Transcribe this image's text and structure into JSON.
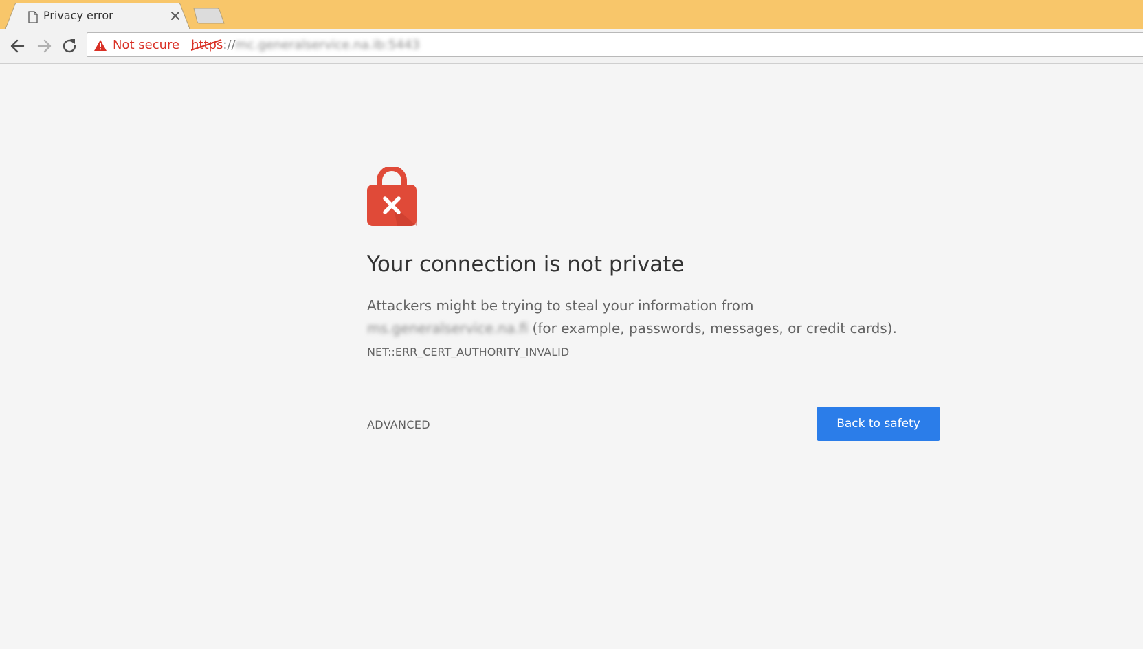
{
  "tab": {
    "title": "Privacy error",
    "page_icon": "document-icon",
    "close_icon": "close-icon"
  },
  "toolbar": {
    "back_icon": "arrow-left-icon",
    "forward_icon": "arrow-right-icon",
    "reload_icon": "reload-icon"
  },
  "omnibox": {
    "security_icon": "warning-triangle-icon",
    "security_label": "Not secure",
    "scheme": "https",
    "separator": "://",
    "host": "mc.generalservice.na.ib:5443"
  },
  "interstitial": {
    "icon": "lock-error-icon",
    "heading": "Your connection is not private",
    "body_prefix": "Attackers might be trying to steal your information from ",
    "body_host": "ms.generalservice.na.fi",
    "body_suffix": " (for example, passwords, messages, or credit cards).",
    "error_code": "NET::ERR_CERT_AUTHORITY_INVALID",
    "advanced_label": "ADVANCED",
    "back_label": "Back to safety"
  },
  "colors": {
    "tabstrip": "#f8c66a",
    "warning_red": "#d93025",
    "lock_red": "#e04a38",
    "primary_blue": "#2b7de9",
    "page_background": "#f5f5f5"
  }
}
